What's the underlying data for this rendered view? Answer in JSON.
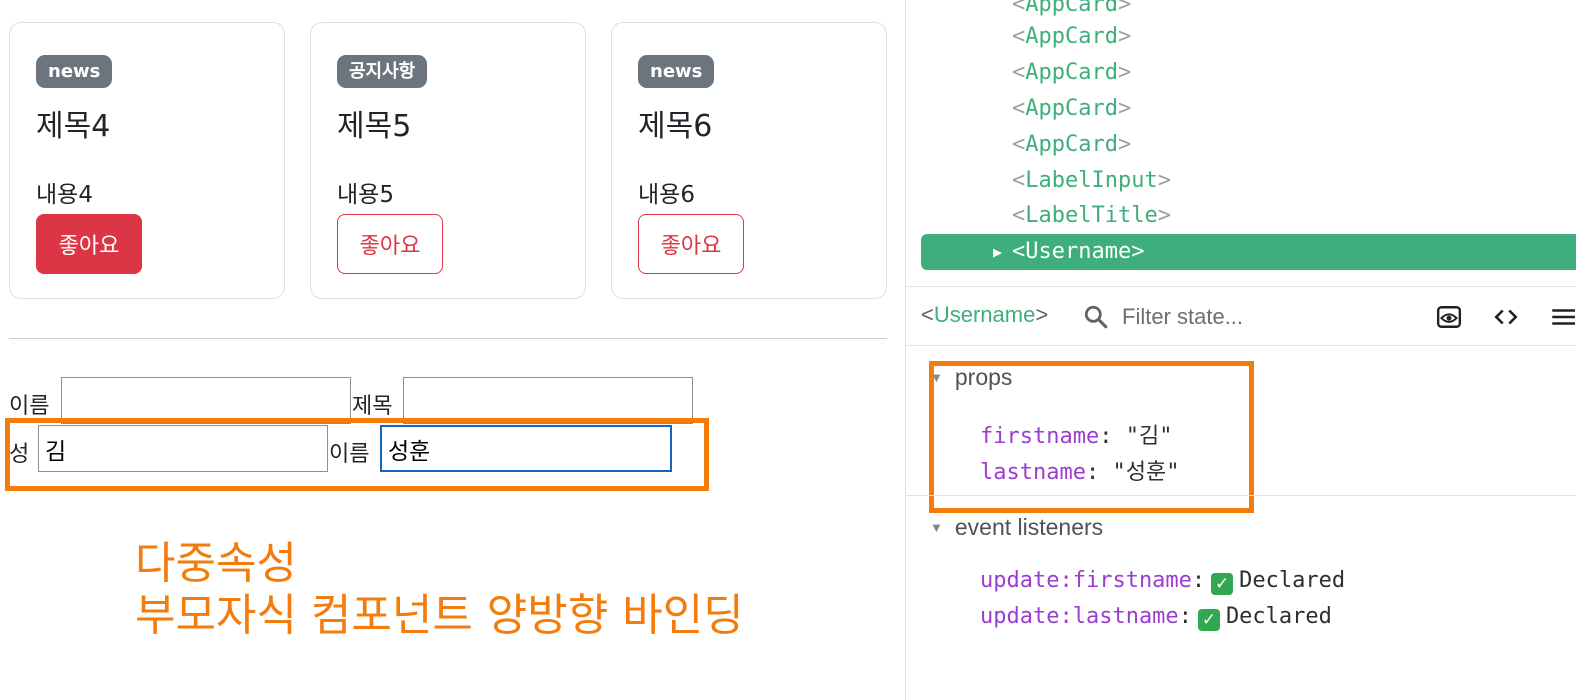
{
  "cards": [
    {
      "badge": "news",
      "title": "제목4",
      "content": "내용4",
      "like_label": "좋아요",
      "liked": true
    },
    {
      "badge": "공지사항",
      "title": "제목5",
      "content": "내용5",
      "like_label": "좋아요",
      "liked": false
    },
    {
      "badge": "news",
      "title": "제목6",
      "content": "내용6",
      "like_label": "좋아요",
      "liked": false
    }
  ],
  "form": {
    "name_label": "이름",
    "name_value": "",
    "title_label": "제목",
    "title_value": "",
    "lastname_label": "성",
    "lastname_value": "김",
    "firstname_label": "이름",
    "firstname_value": "성훈"
  },
  "annotation": {
    "line1": "다중속성",
    "line2": "부모자식 컴포넌트 양방향 바인딩"
  },
  "devtools": {
    "tree": [
      "AppCard",
      "AppCard",
      "AppCard",
      "AppCard",
      "AppCard",
      "LabelInput",
      "LabelTitle"
    ],
    "selected": "Username",
    "component_name": "Username",
    "filter_placeholder": "Filter state...",
    "props_title": "props",
    "props": [
      {
        "key": "firstname",
        "value": "\"김\""
      },
      {
        "key": "lastname",
        "value": "\"성훈\""
      }
    ],
    "events_title": "event listeners",
    "events": [
      {
        "key": "update:firstname",
        "value": "Declared"
      },
      {
        "key": "update:lastname",
        "value": "Declared"
      }
    ]
  },
  "colors": {
    "accent_orange": "#f37c0c",
    "vue_green": "#3eaf7c",
    "danger": "#dc3545",
    "badge": "#6c757d"
  }
}
